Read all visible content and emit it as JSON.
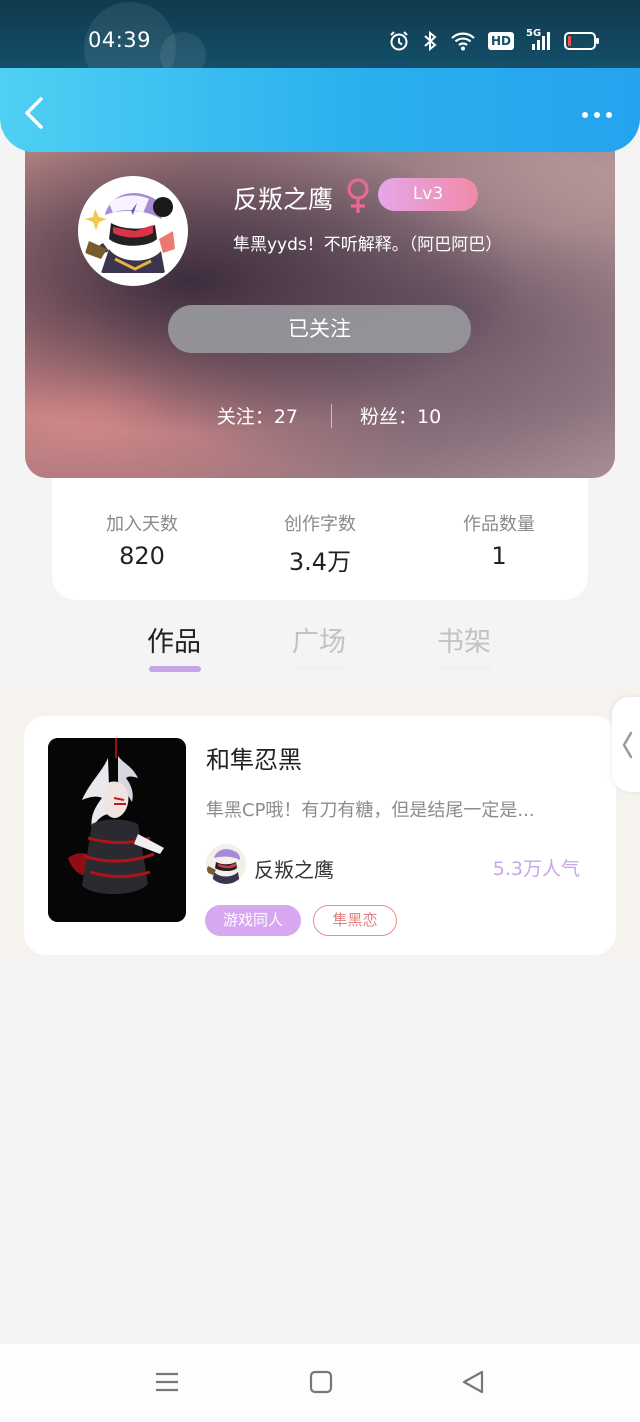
{
  "status_bar": {
    "time": "04:39",
    "icons": [
      "alarm-icon",
      "bluetooth-icon",
      "wifi-icon",
      "hd-icon",
      "signal-5g-icon",
      "battery-icon"
    ],
    "hd_label": "HD",
    "network_label": "5G"
  },
  "nav": {
    "back_icon": "chevron-left-icon",
    "more_icon": "more-dots-icon",
    "accent_start": "#4fd0f3",
    "accent_end": "#25a3ef"
  },
  "profile": {
    "username": "反叛之鹰",
    "gender_icon": "female-icon",
    "level": "Lv3",
    "bio": "隼黑yyds！不听解释。（阿巴阿巴）",
    "follow_button": "已关注",
    "following_text": "关注：27",
    "fans_text": "粉丝：10"
  },
  "stats": [
    {
      "label": "加入天数",
      "value": "820"
    },
    {
      "label": "创作字数",
      "value": "3.4万"
    },
    {
      "label": "作品数量",
      "value": "1"
    }
  ],
  "tabs": [
    {
      "label": "作品",
      "active": true
    },
    {
      "label": "广场",
      "active": false
    },
    {
      "label": "书架",
      "active": false
    }
  ],
  "works": [
    {
      "title": "和隼忍黑",
      "description": "隼黑CP哦！有刀有糖，但是结尾一定是...",
      "author": "反叛之鹰",
      "popularity": "5.3万人气",
      "tags": [
        "游戏同人",
        "隼黑恋"
      ]
    }
  ],
  "side_handle_icon": "chevron-left-icon",
  "system_nav": {
    "icons": [
      "menu-icon",
      "home-square-icon",
      "back-triangle-icon"
    ]
  }
}
